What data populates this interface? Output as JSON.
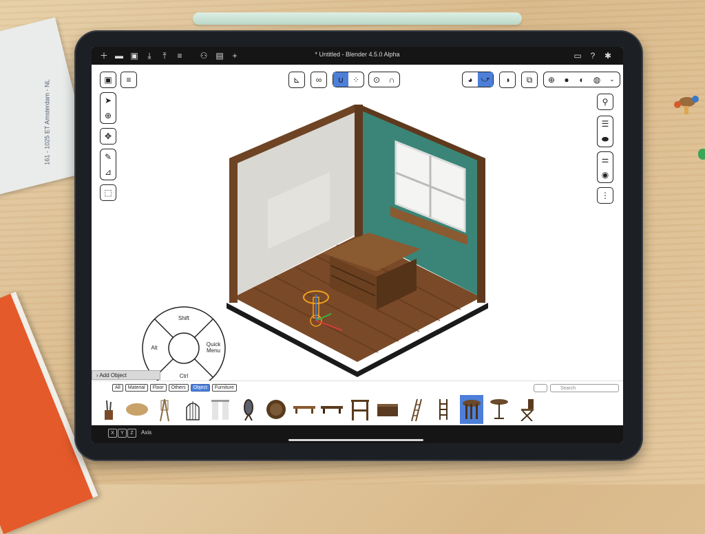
{
  "window": {
    "title": "* Untitled - Blender 4.5.0 Alpha"
  },
  "paper_note": "161 - 1025 ET Amsterdam - NL",
  "topbar": {
    "left_icons": [
      "new-file-icon",
      "open-folder-icon",
      "save-icon",
      "import-icon",
      "export-icon",
      "menu-icon",
      "scene-icon",
      "clapper-icon",
      "add-icon"
    ],
    "right_icons": [
      "display-icon",
      "help-icon",
      "settings-icon"
    ]
  },
  "toolbar": {
    "left": [
      "select-box",
      "menu"
    ],
    "tools": [
      "select-cursor",
      "move",
      "annotate",
      "measure",
      "add-cube"
    ],
    "center_transform": [
      "transform-orientation",
      "link"
    ],
    "snap": [
      "snap-magnet",
      "snap-grid"
    ],
    "proportional": [
      "proportional-edit",
      "falloff-curve"
    ],
    "overlays": [
      "gizmo",
      "overlay-curve"
    ],
    "shading": [
      "xray",
      "wireframe",
      "solid",
      "material",
      "rendered"
    ],
    "right_tools": [
      "zoom",
      "outliner",
      "toggles",
      "properties",
      "visibility",
      "more"
    ]
  },
  "pie_menu": {
    "top": "Shift",
    "left": "Alt",
    "right": "Quick Menu",
    "bottom": "Ctrl"
  },
  "panel": {
    "add_object": "Add Object"
  },
  "asset_browser": {
    "tabs": [
      "All",
      "Material",
      "Floor",
      "Others",
      "Object",
      "Furniture"
    ],
    "active_tab": "Object",
    "search_placeholder": "Search",
    "items": [
      "brushes",
      "palette",
      "easel",
      "birdcage",
      "curtains",
      "mirror",
      "round-rug",
      "bench",
      "bench-2",
      "chair-frame",
      "chest",
      "ladder",
      "ladder-2",
      "round-table",
      "round-table-2",
      "folding-chair"
    ],
    "selected_item": "round-table"
  },
  "bottombar": {
    "keys": [
      "X",
      "Y",
      "Z"
    ],
    "label": "Axis"
  },
  "colors": {
    "accent": "#4d7fd9",
    "topbar": "#151515",
    "wall_teal": "#3a8577",
    "wood": "#6e4424"
  }
}
